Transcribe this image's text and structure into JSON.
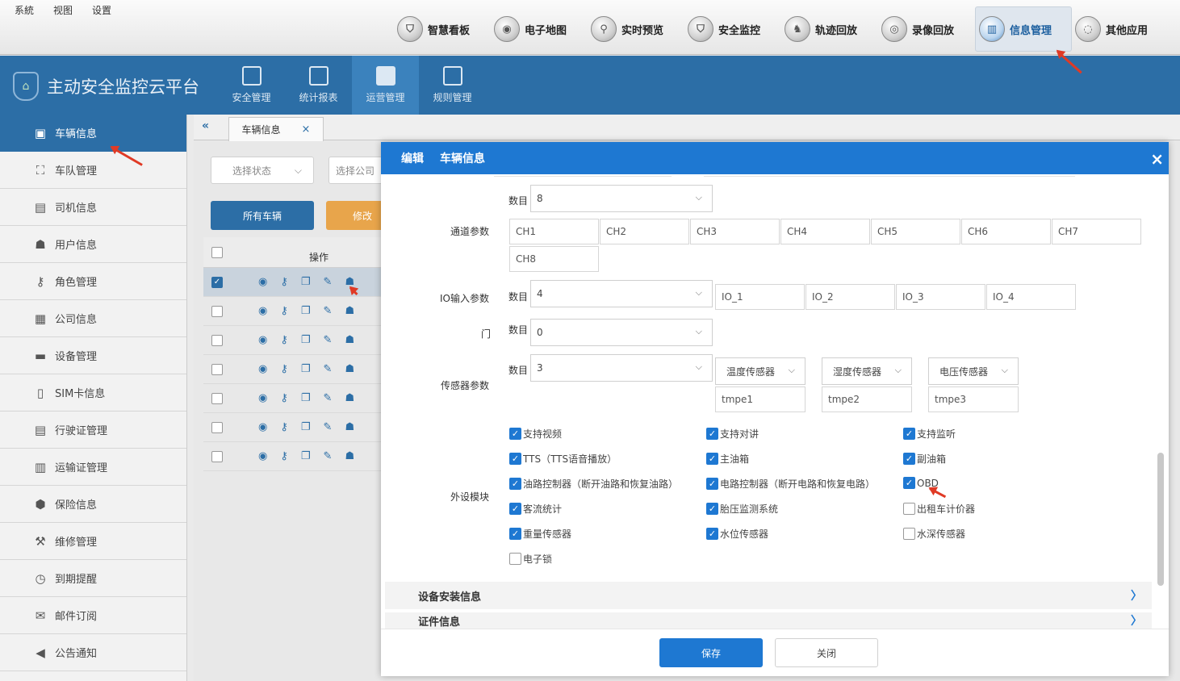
{
  "menus": [
    "系統",
    "视图",
    "设置"
  ],
  "top_nav": [
    {
      "label": "智慧看板",
      "icon": "shield-icon",
      "active": false
    },
    {
      "label": "电子地图",
      "icon": "map-globe-icon",
      "active": false
    },
    {
      "label": "实时预览",
      "icon": "magnifier-icon",
      "active": false
    },
    {
      "label": "安全监控",
      "icon": "shield-icon",
      "active": false
    },
    {
      "label": "轨迹回放",
      "icon": "track-icon",
      "active": false
    },
    {
      "label": "录像回放",
      "icon": "camera-icon",
      "active": false
    },
    {
      "label": "信息管理",
      "icon": "chart-icon",
      "active": true
    },
    {
      "label": "其他应用",
      "icon": "apps-icon",
      "active": false
    }
  ],
  "app_title": "主动安全监控云平台",
  "header_nav": [
    {
      "label": "安全管理",
      "active": false
    },
    {
      "label": "统计报表",
      "active": false
    },
    {
      "label": "运营管理",
      "active": true
    },
    {
      "label": "规则管理",
      "active": false
    }
  ],
  "sidebar": [
    {
      "label": "车辆信息",
      "icon": "bus-icon",
      "active": true
    },
    {
      "label": "车队管理",
      "icon": "fleet-icon",
      "active": false
    },
    {
      "label": "司机信息",
      "icon": "id-card-icon",
      "active": false
    },
    {
      "label": "用户信息",
      "icon": "users-icon",
      "active": false
    },
    {
      "label": "角色管理",
      "icon": "key-icon",
      "active": false
    },
    {
      "label": "公司信息",
      "icon": "building-icon",
      "active": false
    },
    {
      "label": "设备管理",
      "icon": "device-icon",
      "active": false
    },
    {
      "label": "SIM卡信息",
      "icon": "sim-icon",
      "active": false
    },
    {
      "label": "行驶证管理",
      "icon": "license-icon",
      "active": false
    },
    {
      "label": "运输证管理",
      "icon": "permit-icon",
      "active": false
    },
    {
      "label": "保险信息",
      "icon": "insurance-icon",
      "active": false
    },
    {
      "label": "维修管理",
      "icon": "wrench-icon",
      "active": false
    },
    {
      "label": "到期提醒",
      "icon": "clock-icon",
      "active": false
    },
    {
      "label": "邮件订阅",
      "icon": "mail-icon",
      "active": false
    },
    {
      "label": "公告通知",
      "icon": "speaker-icon",
      "active": false
    }
  ],
  "tab": {
    "label": "车辆信息",
    "close": "×",
    "collapse": "«"
  },
  "filters": {
    "status_placeholder": "选择状态",
    "company_placeholder": "选择公司"
  },
  "buttons": {
    "all_vehicles": "所有车辆",
    "modify": "修改"
  },
  "table": {
    "ops_header": "操作",
    "rows": [
      true,
      false,
      false,
      false,
      false,
      false,
      false
    ]
  },
  "modal": {
    "title_action": "编辑",
    "title_object": "车辆信息",
    "close": "×",
    "count_label": "数目",
    "channel": {
      "label": "通道参数",
      "count": "8",
      "values": [
        "CH1",
        "CH2",
        "CH3",
        "CH4",
        "CH5",
        "CH6",
        "CH7",
        "CH8"
      ]
    },
    "io": {
      "label": "IO输入参数",
      "count": "4",
      "values": [
        "IO_1",
        "IO_2",
        "IO_3",
        "IO_4"
      ]
    },
    "door": {
      "label": "门",
      "count": "0"
    },
    "sensor": {
      "label": "传感器参数",
      "count": "3",
      "types": [
        "温度传感器",
        "湿度传感器",
        "电压传感器"
      ],
      "names": [
        "tmpe1",
        "tmpe2",
        "tmpe3"
      ]
    },
    "peripheral": {
      "label": "外设模块",
      "items": [
        {
          "label": "支持视频",
          "checked": true
        },
        {
          "label": "支持对讲",
          "checked": true
        },
        {
          "label": "支持监听",
          "checked": true
        },
        {
          "label": "TTS（TTS语音播放）",
          "checked": true
        },
        {
          "label": "主油箱",
          "checked": true
        },
        {
          "label": "副油箱",
          "checked": true
        },
        {
          "label": "油路控制器（断开油路和恢复油路）",
          "checked": true
        },
        {
          "label": "电路控制器（断开电路和恢复电路）",
          "checked": true
        },
        {
          "label": "OBD",
          "checked": true
        },
        {
          "label": "客流统计",
          "checked": true
        },
        {
          "label": "胎压监测系统",
          "checked": true
        },
        {
          "label": "出租车计价器",
          "checked": false
        },
        {
          "label": "重量传感器",
          "checked": true
        },
        {
          "label": "水位传感器",
          "checked": true
        },
        {
          "label": "水深传感器",
          "checked": false
        },
        {
          "label": "电子锁",
          "checked": false
        }
      ]
    },
    "sections": [
      "设备安装信息",
      "证件信息"
    ],
    "save": "保存",
    "cancel": "关闭"
  },
  "colors": {
    "header_blue": "#2c6ea6",
    "modal_blue": "#1e78d2",
    "accent_orange": "#e8a54b",
    "arrow_red": "#e03a25"
  }
}
